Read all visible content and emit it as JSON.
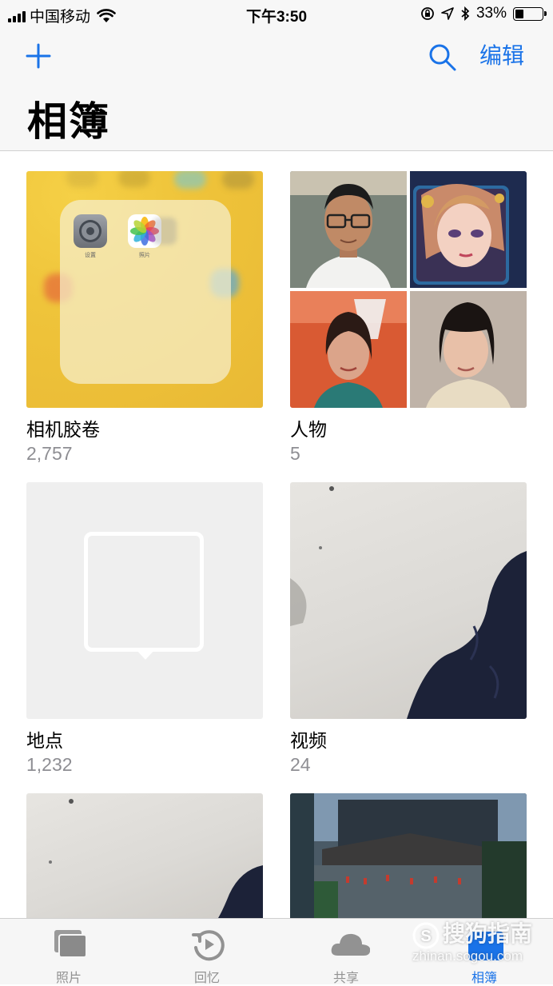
{
  "status_bar": {
    "carrier": "中国移动",
    "time": "下午3:50",
    "battery": "33%"
  },
  "nav": {
    "title": "相簿",
    "edit_label": "编辑"
  },
  "albums": [
    {
      "name": "相机胶卷",
      "count": "2,757"
    },
    {
      "name": "人物",
      "count": "5"
    },
    {
      "name": "地点",
      "count": "1,232"
    },
    {
      "name": "视频",
      "count": "24"
    }
  ],
  "folder_apps": [
    {
      "label": "设置",
      "icon": "settings-gear-icon"
    },
    {
      "label": "照片",
      "icon": "photos-flower-icon"
    }
  ],
  "tabs": [
    {
      "label": "照片",
      "icon": "photos-stack-icon",
      "active": false
    },
    {
      "label": "回忆",
      "icon": "memories-icon",
      "active": false
    },
    {
      "label": "共享",
      "icon": "cloud-icon",
      "active": false
    },
    {
      "label": "相簿",
      "icon": "albums-icon",
      "active": true
    }
  ],
  "watermark": {
    "brand": "搜狗指南",
    "url": "zhinan.sogou.com"
  },
  "colors": {
    "accent": "#1a73e8",
    "secondary_text": "#8e8e93"
  }
}
